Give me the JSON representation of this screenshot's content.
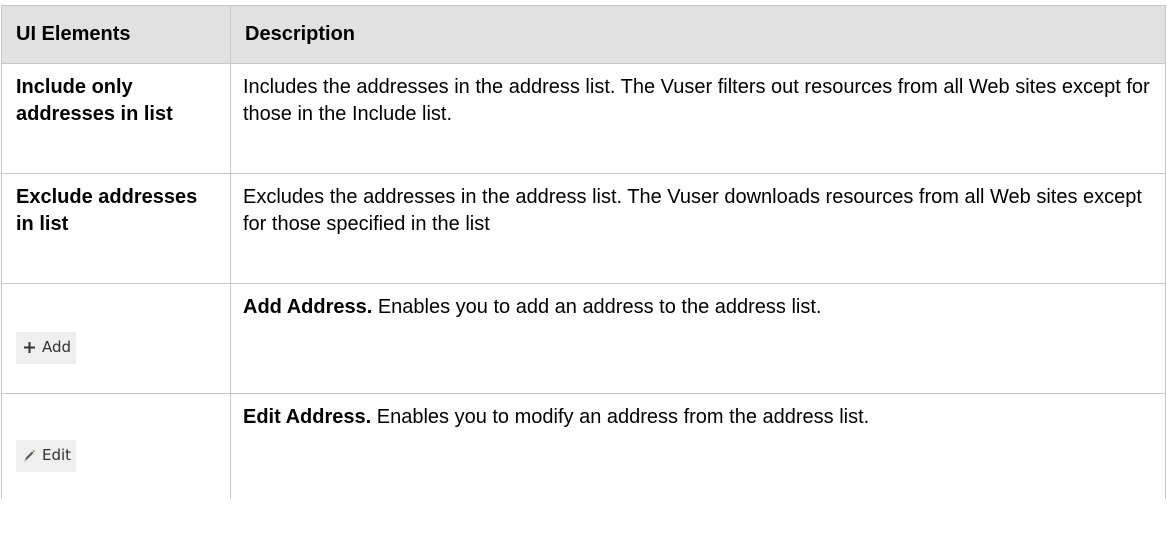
{
  "table": {
    "headers": {
      "col1": "UI Elements",
      "col2": "Description"
    },
    "rows": [
      {
        "element": "Include only addresses in list",
        "description": "Includes the addresses in the address list. The Vuser filters out resources from all Web sites except for those in the Include list."
      },
      {
        "element": "Exclude addresses in list",
        "description": "Excludes the addresses in the address list. The Vuser downloads resources from all Web sites except for those specified in the list"
      },
      {
        "button_label": "Add",
        "button_icon": "plus-icon",
        "description_title": "Add Address.",
        "description": " Enables you to add an address to the address list."
      },
      {
        "button_label": "Edit",
        "button_icon": "pencil-icon",
        "description_title": "Edit Address.",
        "description": " Enables you to modify an address from the address list."
      }
    ]
  }
}
